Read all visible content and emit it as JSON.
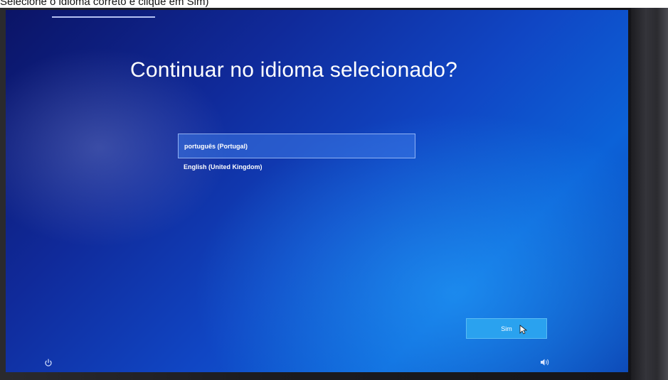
{
  "caption": {
    "text": "Selecione o idioma correto e clique em Sim)"
  },
  "setup": {
    "title": "Continuar no idioma selecionado?",
    "languages": [
      {
        "label": "português (Portugal)",
        "selected": true
      },
      {
        "label": "English (United Kingdom)",
        "selected": false
      }
    ],
    "yes_label": "Sim"
  },
  "icons": {
    "power": "power-icon",
    "volume": "volume-icon",
    "cursor": "mouse-pointer-icon"
  },
  "colors": {
    "screen_background": "#1046c4",
    "button_background": "#2aa2ef",
    "selected_item_border": "#b4cdff"
  }
}
